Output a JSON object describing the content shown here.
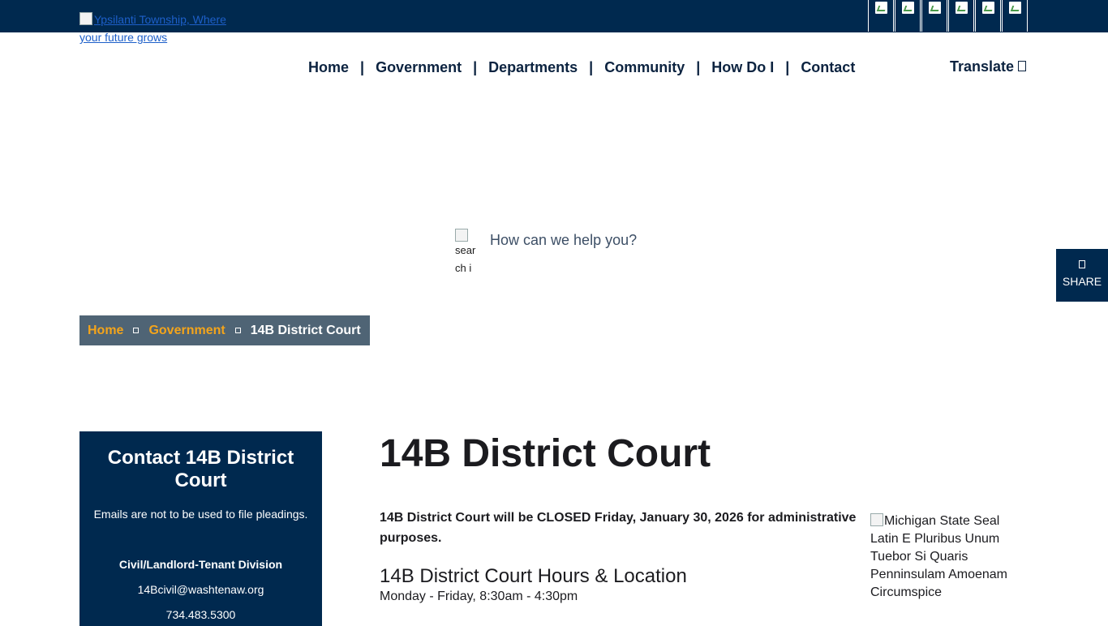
{
  "header": {
    "logo_alt": "Ypsilanti Township, Where your future grows",
    "social_icons": [
      "facebook-icon",
      "twitter-icon",
      "instagram-icon",
      "youtube-icon",
      "linkedin-icon",
      "nextdoor-icon"
    ]
  },
  "nav": {
    "items": [
      "Home",
      "Government",
      "Departments",
      "Community",
      "How Do I",
      "Contact"
    ],
    "separator": "|",
    "translate_label": "Translate"
  },
  "search": {
    "icon_alt": "search icon",
    "placeholder": "How can we help you?"
  },
  "share": {
    "label": "SHARE"
  },
  "breadcrumb": {
    "items": [
      "Home",
      "Government"
    ],
    "current": "14B District Court"
  },
  "sidebar": {
    "title": "Contact 14B District Court",
    "note": "Emails are not to be used to file pleadings.",
    "division": "Civil/Landlord-Tenant Division",
    "email": "14Bcivil@washtenaw.org",
    "phone": "734.483.5300"
  },
  "main": {
    "title": "14B District Court",
    "notice": "14B District Court will be CLOSED Friday, January 30, 2026 for administrative purposes.",
    "hours_heading": "14B District Court Hours & Location",
    "hours_text": "Monday - Friday, 8:30am - 4:30pm",
    "seal_alt": "Michigan State Seal Latin E Pluribus Unum Tuebor Si Quaris Penninsulam Amoenam Circumspice"
  },
  "colors": {
    "navy": "#00294f",
    "accent": "#f3a41b",
    "breadcrumb_bg": "#4f6475"
  }
}
